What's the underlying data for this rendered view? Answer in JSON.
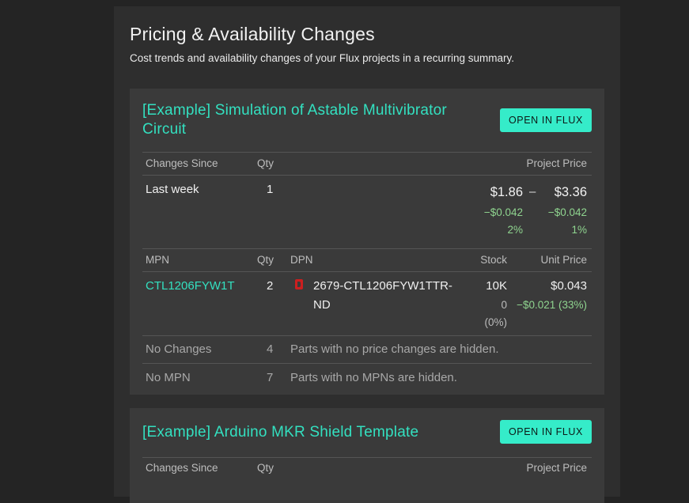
{
  "page": {
    "title": "Pricing & Availability Changes",
    "subtitle": "Cost trends and availability changes of your Flux projects in a recurring summary."
  },
  "projects": [
    {
      "title": "[Example] Simulation of Astable Multivibrator Circuit",
      "button": "OPEN IN FLUX",
      "summary_headers": {
        "changes_since": "Changes Since",
        "qty": "Qty",
        "project_price": "Project Price"
      },
      "summary_row": {
        "changes_since": "Last week",
        "qty": "1",
        "price_low": "$1.86",
        "price_sep": "–",
        "price_high": "$3.36",
        "low_delta": "−$0.042",
        "low_pct": "2%",
        "high_delta": "−$0.042",
        "high_pct": "1%"
      },
      "parts_headers": {
        "mpn": "MPN",
        "qty": "Qty",
        "dpn": "DPN",
        "stock": "Stock",
        "unit_price": "Unit Price"
      },
      "parts": [
        {
          "mpn": "CTL1206FYW1T",
          "qty": "2",
          "distributor_icon": "digikey-icon",
          "dpn_line1": "2679-CTL1206FYW1TTR-",
          "dpn_line2": "ND",
          "stock": "10K",
          "stock_delta": "0",
          "stock_pct": "(0%)",
          "unit_price": "$0.043",
          "unit_delta": "−$0.021 (33%)"
        }
      ],
      "notes": [
        {
          "label": "No Changes",
          "count": "4",
          "text": "Parts with no price changes are hidden."
        },
        {
          "label": "No MPN",
          "count": "7",
          "text": "Parts with no MPNs are hidden."
        }
      ]
    },
    {
      "title": "[Example] Arduino MKR Shield Template",
      "button": "OPEN IN FLUX",
      "summary_headers": {
        "changes_since": "Changes Since",
        "qty": "Qty",
        "project_price": "Project Price"
      }
    }
  ],
  "colors": {
    "accent": "#35ecc9",
    "title_teal": "#33e0c0",
    "delta_green": "#8fd48f",
    "distributor_red": "#cc1f1f"
  }
}
